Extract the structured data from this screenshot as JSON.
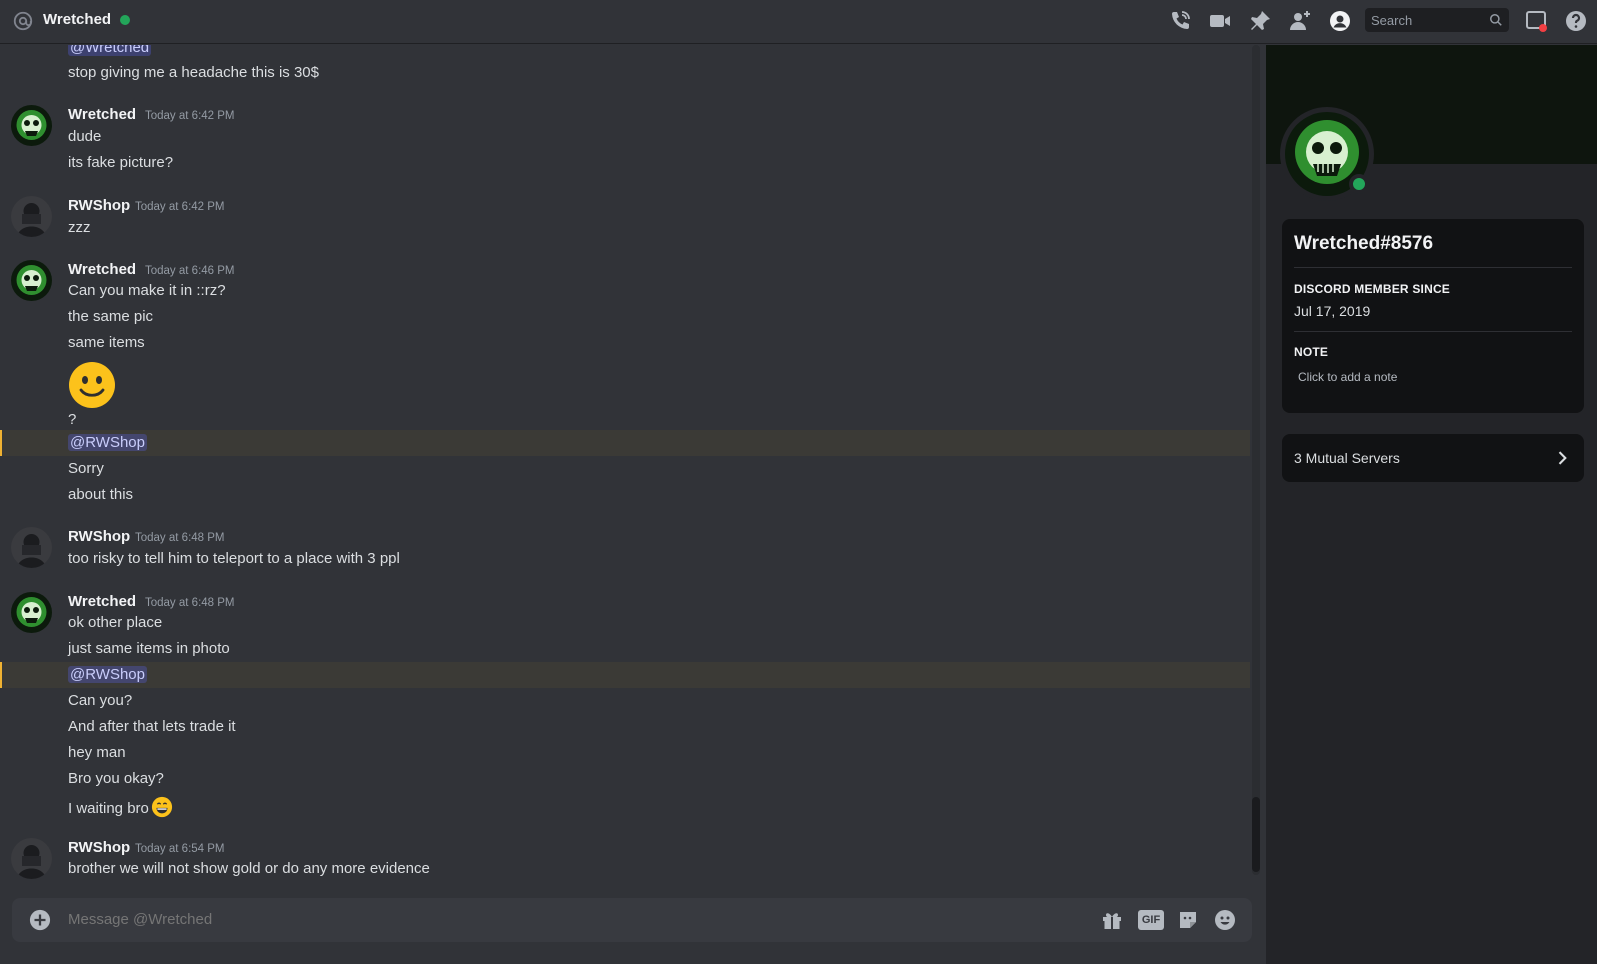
{
  "header": {
    "title": "Wretched",
    "search_placeholder": "Search",
    "icons": [
      "at-icon",
      "phone-call-icon",
      "video-call-icon",
      "pin-icon",
      "add-friend-icon",
      "profile-icon",
      "inbox-icon",
      "help-icon"
    ]
  },
  "messages": {
    "top": {
      "mention": "@Wretched",
      "line": "stop giving me a headache this is 30$"
    },
    "group1": {
      "author": "Wretched",
      "timestamp": "Today at 6:42 PM",
      "lines": [
        "dude",
        "its fake picture?"
      ]
    },
    "group2": {
      "author": "RWShop",
      "timestamp": "Today at 6:42 PM",
      "lines": [
        "zzz"
      ]
    },
    "group3": {
      "author": "Wretched",
      "timestamp": "Today at 6:46 PM",
      "lines": [
        "Can you make it in ::rz?",
        "the same pic",
        "same items",
        "?",
        "@RWShop",
        "Sorry",
        "about this"
      ],
      "emoji": "slightly-smiling-face"
    },
    "group4": {
      "author": "RWShop",
      "timestamp": "Today at 6:48 PM",
      "lines": [
        "too risky to tell him to teleport to a place with 3 ppl"
      ]
    },
    "group5": {
      "author": "Wretched",
      "timestamp": "Today at 6:48 PM",
      "lines": [
        "ok other place",
        "just same items in photo",
        "@RWShop",
        "Can you?",
        "And after that lets trade it",
        "hey man",
        "Bro you okay?",
        "I waiting bro"
      ],
      "emoji": "grinning-face"
    },
    "group6": {
      "author": "RWShop",
      "timestamp": "Today at 6:54 PM",
      "lines": [
        "brother we will not show gold or do any more evidence"
      ]
    }
  },
  "composer": {
    "placeholder": "Message @Wretched",
    "gif_label": "GIF"
  },
  "profile": {
    "name": "Wretched#8576",
    "member_since_label": "DISCORD MEMBER SINCE",
    "member_since": "Jul 17, 2019",
    "note_label": "NOTE",
    "note_placeholder": "Click to add a note",
    "mutual_servers": "3 Mutual Servers"
  },
  "colors": {
    "background": "#313338",
    "panel": "#232428",
    "online": "#23a55a",
    "mention_highlight": "#3b3a36",
    "mention_text": "#c9cdfb"
  }
}
